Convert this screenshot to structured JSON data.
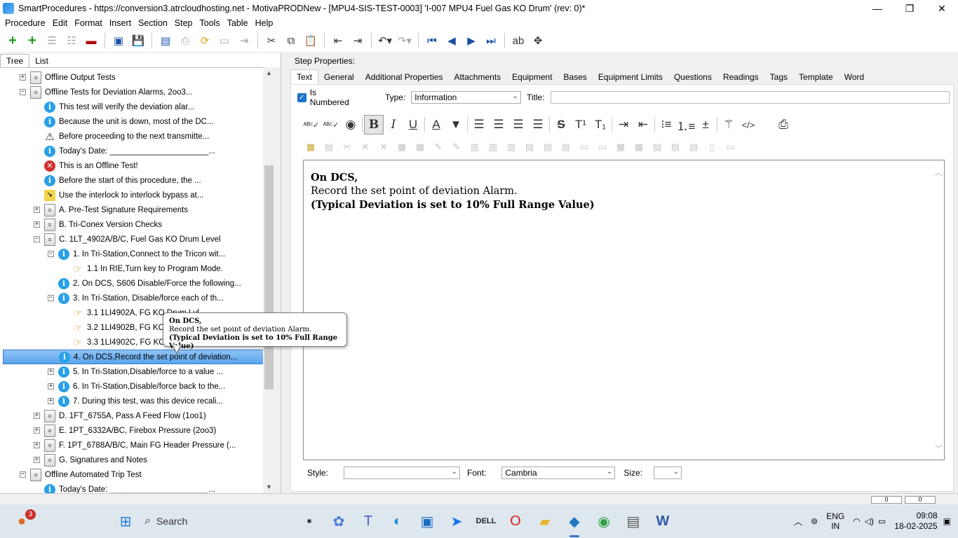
{
  "window": {
    "title": "SmartProcedures - https://conversion3.atrcloudhosting.net - MotivaPRODNew - [MPU4-SIS-TEST-0003] 'I-007 MPU4 Fuel Gas KO Drum' (rev: 0)*",
    "min": "—",
    "max": "❐",
    "close": "✕"
  },
  "menu": [
    "Procedure",
    "Edit",
    "Format",
    "Insert",
    "Section",
    "Step",
    "Tools",
    "Table",
    "Help"
  ],
  "left_tabs": [
    "Tree",
    "List"
  ],
  "tree": [
    {
      "indent": 0,
      "exp": "+",
      "icon": "folder",
      "label": "Offline Output Tests"
    },
    {
      "indent": 0,
      "exp": "−",
      "icon": "folder",
      "label": "Offline Tests for Deviation Alarms, 2oo3..."
    },
    {
      "indent": 1,
      "exp": "",
      "icon": "info",
      "label": "This test will verify the deviation alar..."
    },
    {
      "indent": 1,
      "exp": "",
      "icon": "info",
      "label": "Because the unit is down, most of the DC..."
    },
    {
      "indent": 1,
      "exp": "",
      "icon": "warn",
      "label": "Before proceeding to the next transmitte..."
    },
    {
      "indent": 1,
      "exp": "",
      "icon": "info",
      "label": "Today's Date: ______________________..."
    },
    {
      "indent": 1,
      "exp": "",
      "icon": "err",
      "label": "This is an Offline Test!"
    },
    {
      "indent": 1,
      "exp": "",
      "icon": "info",
      "label": "Before the start of this procedure, the ..."
    },
    {
      "indent": 1,
      "exp": "",
      "icon": "key",
      "label": "Use the interlock to interlock bypass at..."
    },
    {
      "indent": 1,
      "exp": "+",
      "icon": "folder",
      "label": "A. Pre-Test Signature Requirements"
    },
    {
      "indent": 1,
      "exp": "+",
      "icon": "folder",
      "label": "B. Tri-Conex Version Checks"
    },
    {
      "indent": 1,
      "exp": "−",
      "icon": "folder",
      "label": "C. 1LT_4902A/B/C, Fuel Gas KO Drum Level"
    },
    {
      "indent": 2,
      "exp": "−",
      "icon": "info",
      "label": "1. In Tri-Station,Connect to the Tricon wit..."
    },
    {
      "indent": 3,
      "exp": "",
      "icon": "hand",
      "label": "1.1 In RIE,Turn key to Program Mode."
    },
    {
      "indent": 2,
      "exp": "",
      "icon": "info",
      "label": "2. On DCS, S606 Disable/Force the following..."
    },
    {
      "indent": 2,
      "exp": "−",
      "icon": "info",
      "label": "3. In Tri-Station, Disable/force each of th..."
    },
    {
      "indent": 3,
      "exp": "",
      "icon": "hand",
      "label": "3.1 1LI4902A, FG KO Drum Lvl"
    },
    {
      "indent": 3,
      "exp": "",
      "icon": "hand",
      "label": "3.2 1LI4902B, FG KO Drum Lvl"
    },
    {
      "indent": 3,
      "exp": "",
      "icon": "hand",
      "label": "3.3 1LI4902C, FG KO Drum Lvl"
    },
    {
      "indent": 2,
      "exp": "",
      "icon": "info",
      "label": "4. On DCS,Record the set point of deviation...",
      "selected": true
    },
    {
      "indent": 2,
      "exp": "+",
      "icon": "info",
      "label": "5. In Tri-Station,Disable/force to a value ..."
    },
    {
      "indent": 2,
      "exp": "+",
      "icon": "info",
      "label": "6. In Tri-Station,Disable/force back to the..."
    },
    {
      "indent": 2,
      "exp": "+",
      "icon": "info",
      "label": "7. During this test, was this device recali..."
    },
    {
      "indent": 1,
      "exp": "+",
      "icon": "folder",
      "label": "D. 1FT_6755A, Pass A Feed Flow (1oo1)"
    },
    {
      "indent": 1,
      "exp": "+",
      "icon": "folder",
      "label": "E. 1PT_6332A/BC, Firebox Pressure (2oo3)"
    },
    {
      "indent": 1,
      "exp": "+",
      "icon": "folder",
      "label": "F. 1PT_6788A/B/C, Main FG Header Pressure (..."
    },
    {
      "indent": 1,
      "exp": "+",
      "icon": "folder",
      "label": "G. Signatures and Notes"
    },
    {
      "indent": 0,
      "exp": "−",
      "icon": "folder",
      "label": "Offline Automated Trip Test"
    },
    {
      "indent": 1,
      "exp": "",
      "icon": "info",
      "label": "Today's Date: ______________________..."
    }
  ],
  "right": {
    "section_label": "Step Properties:",
    "tabs": [
      "Text",
      "General",
      "Additional Properties",
      "Attachments",
      "Equipment",
      "Bases",
      "Equipment Limits",
      "Questions",
      "Readings",
      "Tags",
      "Template",
      "Word"
    ],
    "is_numbered_label": "Is Numbered",
    "type_label": "Type:",
    "type_value": "Information",
    "title_label": "Title:",
    "title_value": "",
    "editor": {
      "line1": "On DCS,",
      "line2": "Record the set point of deviation Alarm.",
      "line3": "(Typical Deviation is set to 10% Full Range Value)"
    },
    "style_label": "Style:",
    "style_value": "",
    "font_label": "Font:",
    "font_value": "Cambria",
    "size_label": "Size:",
    "size_value": ""
  },
  "tooltip": {
    "line1": "On DCS,",
    "line2": "Record the set point of deviation Alarm.",
    "line3": "(Typical Deviation is set to 10% Full Range Value)"
  },
  "status_cells": [
    "0",
    "0"
  ],
  "taskbar": {
    "notification_count": "3",
    "search_label": "Search",
    "lang_line1": "ENG",
    "lang_line2": "IN",
    "time": "09:08",
    "date": "18-02-2025"
  }
}
